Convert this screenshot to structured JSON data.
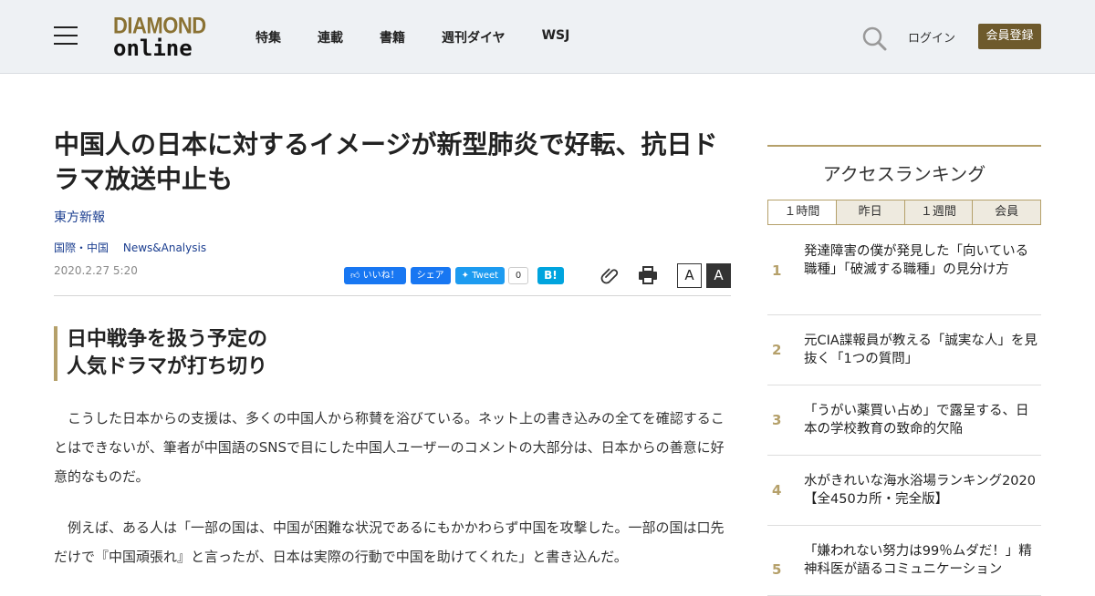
{
  "header": {
    "logo_line1": "DIAMOND",
    "logo_line2": "online",
    "nav": [
      "特集",
      "連載",
      "書籍",
      "週刊ダイヤ",
      "WSJ"
    ],
    "login": "ログイン",
    "register": "会員登録"
  },
  "article": {
    "title": "中国人の日本に対するイメージが新型肺炎で好転、抗日ドラマ放送中止も",
    "source": "東方新報",
    "categories": [
      "国際・中国",
      "News&Analysis"
    ],
    "date": "2020.2.27 5:20",
    "social": {
      "like": "いいね！",
      "share": "シェア",
      "tweet": "Tweet",
      "tweet_count": "0",
      "hatena": "B!"
    },
    "font_small": "A",
    "font_large": "A",
    "subhead_line1": "日中戦争を扱う予定の",
    "subhead_line2": "人気ドラマが打ち切り",
    "paragraphs": [
      "こうした日本からの支援は、多くの中国人から称賛を浴びている。ネット上の書き込みの全てを確認することはできないが、筆者が中国語のSNSで目にした中国人ユーザーのコメントの大部分は、日本からの善意に好意的なものだ。",
      "例えば、ある人は「一部の国は、中国が困難な状況であるにもかかわらず中国を攻撃した。一部の国は口先だけで『中国頑張れ』と言ったが、日本は実際の行動で中国を助けてくれた」と書き込んだ。"
    ]
  },
  "ranking": {
    "title": "アクセスランキング",
    "tabs": [
      "１時間",
      "昨日",
      "１週間",
      "会員"
    ],
    "items": [
      {
        "rank": "1",
        "text": "発達障害の僕が発見した「向いている職種」「破滅する職種」の見分け方"
      },
      {
        "rank": "2",
        "text": "元CIA諜報員が教える「誠実な人」を見抜く「1つの質問」"
      },
      {
        "rank": "3",
        "text": "「うがい薬買い占め」で露呈する、日本の学校教育の致命的欠陥"
      },
      {
        "rank": "4",
        "text": "水がきれいな海水浴場ランキング2020【全450カ所・完全版】"
      },
      {
        "rank": "5",
        "text": "「嫌われない努力は99％ムダだ！」精神科医が語るコミュニケーション"
      }
    ]
  }
}
